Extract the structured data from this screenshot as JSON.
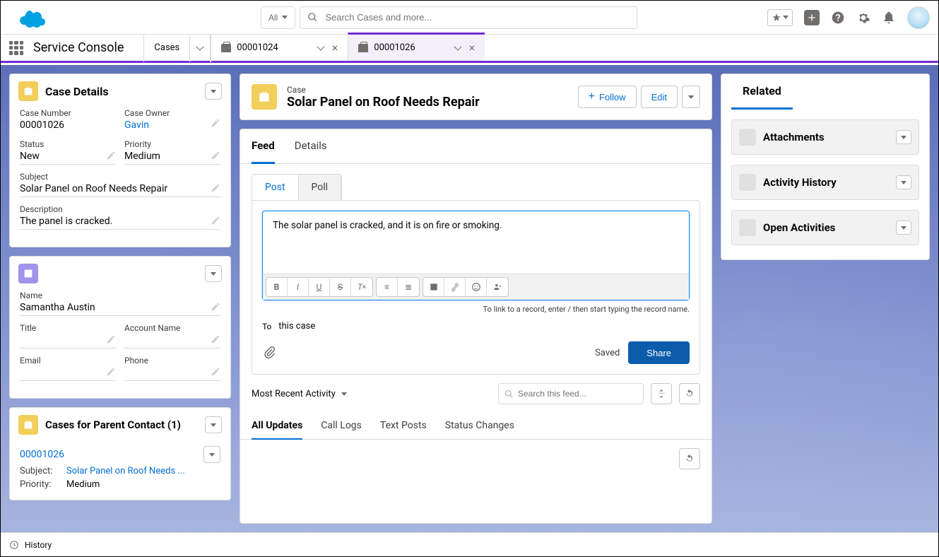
{
  "header": {
    "search_scope": "All",
    "search_placeholder": "Search Cases and more..."
  },
  "nav": {
    "app_name": "Service Console",
    "object_tab": "Cases",
    "workspace_tabs": [
      {
        "label": "00001024",
        "active": false
      },
      {
        "label": "00001026",
        "active": true
      }
    ]
  },
  "case_details": {
    "title": "Case Details",
    "case_number_label": "Case Number",
    "case_number": "00001026",
    "case_owner_label": "Case Owner",
    "case_owner": "Gavin",
    "status_label": "Status",
    "status": "New",
    "priority_label": "Priority",
    "priority": "Medium",
    "subject_label": "Subject",
    "subject": "Solar Panel on Roof Needs Repair",
    "description_label": "Description",
    "description": "The panel is cracked."
  },
  "contact_details": {
    "title": "",
    "name_label": "Name",
    "name": "Samantha Austin",
    "title_label": "Title",
    "account_label": "Account Name",
    "account": "",
    "email_label": "Email",
    "email": "",
    "phone_label": "Phone",
    "phone": ""
  },
  "parent_cases": {
    "title": "Cases for Parent Contact (1)",
    "items": [
      {
        "number": "00001026",
        "subject_label": "Subject:",
        "subject": "Solar Panel on Roof Needs ...",
        "priority_label": "Priority:",
        "priority": "Medium"
      }
    ]
  },
  "highlights": {
    "type": "Case",
    "subject": "Solar Panel on Roof Needs Repair",
    "follow": "Follow",
    "edit": "Edit"
  },
  "record_tabs": {
    "feed": "Feed",
    "details": "Details"
  },
  "publisher": {
    "post": "Post",
    "poll": "Poll",
    "text": "The solar panel is cracked, and it is on fire or smoking.",
    "hint": "To link to a record, enter / then start typing the record name.",
    "to_label": "To",
    "to_value": "this case",
    "saved": "Saved",
    "share": "Share"
  },
  "feed": {
    "sort": "Most Recent Activity",
    "search_placeholder": "Search this feed...",
    "filters": {
      "all": "All Updates",
      "calls": "Call Logs",
      "text": "Text Posts",
      "status": "Status Changes"
    }
  },
  "related": {
    "title": "Related",
    "cards": [
      {
        "label": "Attachments"
      },
      {
        "label": "Activity History"
      },
      {
        "label": "Open Activities"
      }
    ]
  },
  "utility": {
    "history": "History"
  }
}
